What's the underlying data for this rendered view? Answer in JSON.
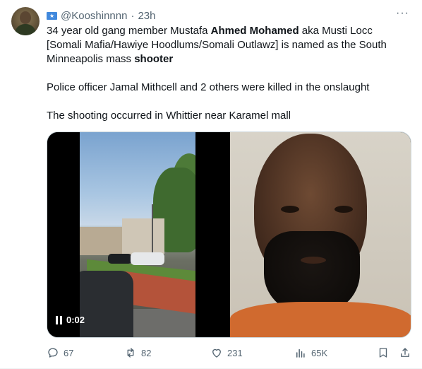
{
  "tweet": {
    "flag_icon": "somalia-flag-icon",
    "handle": "@Kooshinnnn",
    "separator": "·",
    "time": "23h",
    "more_icon": "more-icon",
    "text": {
      "line1_a": "34 year old gang member Mustafa ",
      "line1_bold": "Ahmed Mohamed",
      "line1_b": " aka Musti Locc [Somali Mafia/Hawiye Hoodlums/Somali Outlawz] is named as the South Minneapolis mass ",
      "line1_bold2": "shooter",
      "line2": "Police officer Jamal Mithcell and 2 others were killed in the onslaught",
      "line3": "The shooting occurred in Whittier near Karamel mall"
    },
    "media": {
      "video_timecode": "0:02"
    },
    "actions": {
      "replies": "67",
      "reposts": "82",
      "likes": "231",
      "views": "65K"
    }
  }
}
